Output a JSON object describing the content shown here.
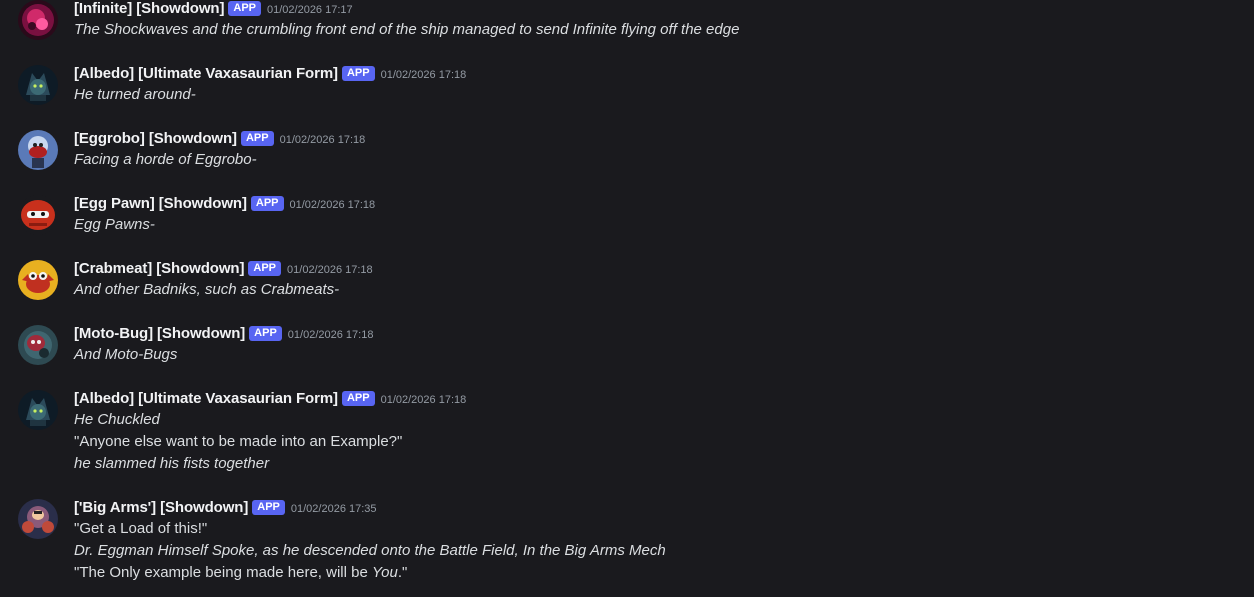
{
  "messages": [
    {
      "username": "[Infinite] [Showdown]",
      "badge": "APP",
      "timestamp": "01/02/2026 17:17",
      "avatar_icon": "infinite-avatar-icon",
      "lines": [
        {
          "text": "The Shockwaves and the crumbling front end of the ship managed to send Infinite flying off the edge",
          "italic": true
        }
      ]
    },
    {
      "username": "[Albedo] [Ultimate Vaxasaurian Form]",
      "badge": "APP",
      "timestamp": "01/02/2026 17:18",
      "avatar_icon": "albedo-avatar-icon",
      "lines": [
        {
          "text": "He turned around-",
          "italic": true
        }
      ]
    },
    {
      "username": "[Eggrobo] [Showdown]",
      "badge": "APP",
      "timestamp": "01/02/2026 17:18",
      "avatar_icon": "eggrobo-avatar-icon",
      "lines": [
        {
          "text": "Facing a horde of Eggrobo-",
          "italic": true
        }
      ]
    },
    {
      "username": "[Egg Pawn] [Showdown]",
      "badge": "APP",
      "timestamp": "01/02/2026 17:18",
      "avatar_icon": "egg-pawn-avatar-icon",
      "lines": [
        {
          "text": "Egg Pawns-",
          "italic": true
        }
      ]
    },
    {
      "username": "[Crabmeat] [Showdown]",
      "badge": "APP",
      "timestamp": "01/02/2026 17:18",
      "avatar_icon": "crabmeat-avatar-icon",
      "lines": [
        {
          "text": "And other Badniks, such as Crabmeats-",
          "italic": true
        }
      ]
    },
    {
      "username": "[Moto-Bug] [Showdown]",
      "badge": "APP",
      "timestamp": "01/02/2026 17:18",
      "avatar_icon": "moto-bug-avatar-icon",
      "lines": [
        {
          "text": "And Moto-Bugs",
          "italic": true
        }
      ]
    },
    {
      "username": "[Albedo] [Ultimate Vaxasaurian Form]",
      "badge": "APP",
      "timestamp": "01/02/2026 17:18",
      "avatar_icon": "albedo-avatar-icon",
      "lines": [
        {
          "text": "He Chuckled",
          "italic": true
        },
        {
          "text": "\"Anyone else want to be made into an Example?\"",
          "italic": false
        },
        {
          "text": "he slammed his fists together",
          "italic": true
        }
      ]
    },
    {
      "username": "['Big Arms'] [Showdown]",
      "badge": "APP",
      "timestamp": "01/02/2026 17:35",
      "avatar_icon": "big-arms-avatar-icon",
      "lines": [
        {
          "text": "\"Get a Load of this!\"",
          "italic": false
        },
        {
          "text": "Dr. Eggman Himself Spoke, as he descended onto the Battle Field, In the Big Arms Mech",
          "italic": true
        },
        {
          "segments": [
            {
              "text": "\"The Only example being made here, will be ",
              "italic": false
            },
            {
              "text": "You",
              "italic": true
            },
            {
              "text": ".\"",
              "italic": false
            }
          ]
        }
      ]
    }
  ]
}
